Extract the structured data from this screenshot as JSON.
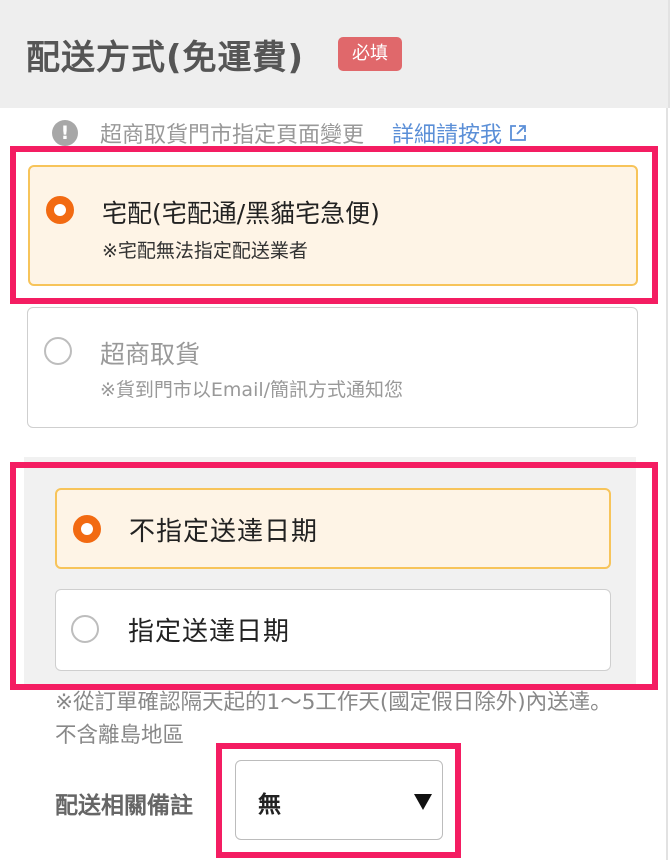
{
  "header": {
    "title": "配送方式(免運費)",
    "required_badge": "必填"
  },
  "notice": {
    "text": "超商取貨門市指定頁面變更",
    "link": "詳細請按我",
    "icon": "exclamation-icon",
    "link_icon": "external-link-icon"
  },
  "delivery_options": [
    {
      "title": "宅配(宅配通/黑貓宅急便)",
      "note": "※宅配無法指定配送業者",
      "selected": true
    },
    {
      "title": "超商取貨",
      "note": "※貨到門市以Email/簡訊方式通知您",
      "selected": false
    }
  ],
  "date_options": [
    {
      "label": "不指定送達日期",
      "selected": true
    },
    {
      "label": "指定送達日期",
      "selected": false
    }
  ],
  "date_note": "※從訂單確認隔天起的1～5工作天(國定假日除外)內送達。不含離島地區",
  "remarks": {
    "label": "配送相關備註",
    "value": "無"
  },
  "colors": {
    "accent": "#f26a12",
    "selected_bg": "#fef4e6",
    "selected_border": "#f7c45a",
    "badge": "#e0686b",
    "link": "#5b8fd7",
    "highlight": "#f41d62"
  }
}
